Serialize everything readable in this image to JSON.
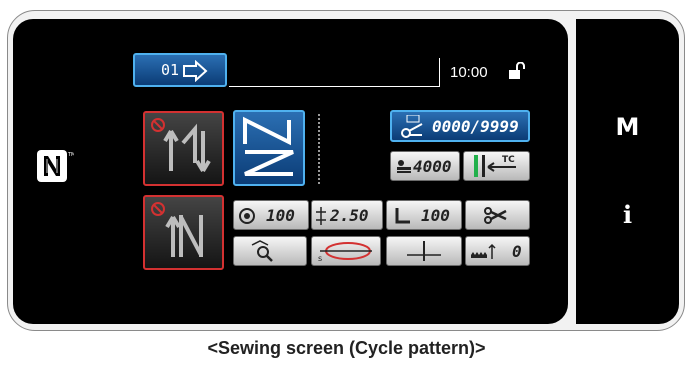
{
  "screen": {
    "step_label": "01",
    "clock": "10:00",
    "bobbin_counter": "0000/9999",
    "thread_counter": "4000",
    "tc_label": "TC",
    "tension_value": "100",
    "stitch_length": "2.50",
    "presser_foot_value": "100",
    "feed_value": "0"
  },
  "side": {
    "menu_label": "M",
    "info_label": "i"
  },
  "caption": "<Sewing screen (Cycle pattern)>"
}
